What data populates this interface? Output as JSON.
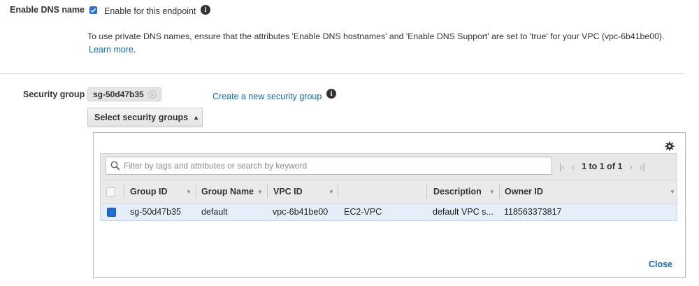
{
  "dns": {
    "label": "Enable DNS name",
    "checkbox_label": "Enable for this endpoint",
    "checked": true,
    "note": "To use private DNS names, ensure that the attributes 'Enable DNS hostnames' and 'Enable DNS Support' are set to 'true' for your VPC (vpc-6b41be00).",
    "learn_more": "Learn more",
    "learn_more_suffix": "."
  },
  "security": {
    "label": "Security group",
    "token": "sg-50d47b35",
    "create_link": "Create a new security group",
    "select_button": "Select security groups"
  },
  "table": {
    "filter_placeholder": "Filter by tags and attributes or search by keyword",
    "pager_text": "1 to 1 of 1",
    "columns": {
      "group_id": "Group ID",
      "group_name": "Group Name",
      "vpc_id": "VPC ID",
      "description": "Description",
      "owner_id": "Owner ID"
    },
    "rows": [
      {
        "group_id": "sg-50d47b35",
        "group_name": "default",
        "vpc_id": "vpc-6b41be00",
        "vpc_tag": "EC2-VPC",
        "description": "default VPC s...",
        "owner_id": "118563373817",
        "selected": true
      }
    ],
    "close": "Close"
  },
  "icons": {
    "info": "info-icon",
    "settings": "gear-icon",
    "first_page": "first-page-icon",
    "prev_page": "prev-page-icon",
    "next_page": "next-page-icon",
    "last_page": "last-page-icon",
    "search": "search-icon"
  },
  "colors": {
    "link": "#0e6bb8",
    "checkbox": "#2b6ee0",
    "selected_row": "#e6eef9"
  }
}
